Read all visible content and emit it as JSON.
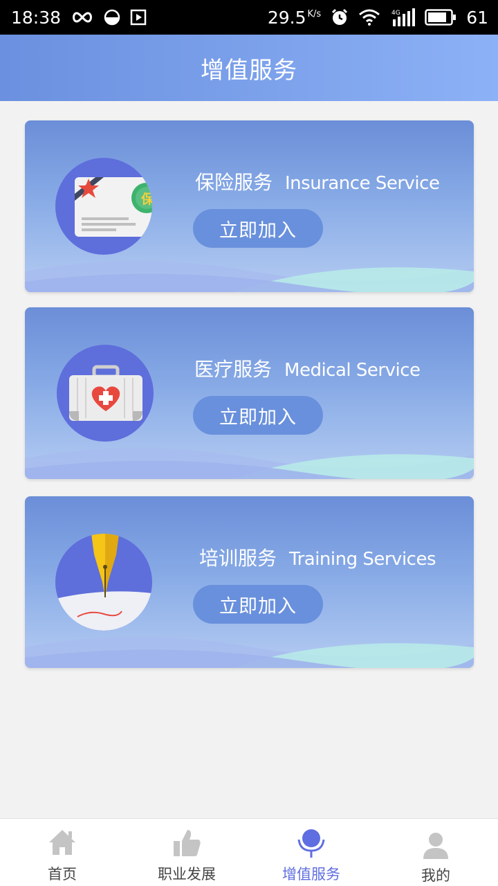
{
  "status_bar": {
    "time": "18:38",
    "speed": "29.5",
    "speed_unit": "K/s",
    "network": "4G",
    "battery": "61"
  },
  "header": {
    "title": "增值服务"
  },
  "cards": [
    {
      "title_cn": "保险服务",
      "title_en": "Insurance Service",
      "button": "立即加入",
      "icon": "insurance-card-icon",
      "badge_char": "保"
    },
    {
      "title_cn": "医疗服务",
      "title_en": "Medical Service",
      "button": "立即加入",
      "icon": "medical-kit-icon"
    },
    {
      "title_cn": "培训服务",
      "title_en": "Training Services",
      "button": "立即加入",
      "icon": "fountain-pen-icon"
    }
  ],
  "nav": {
    "items": [
      {
        "label": "首页",
        "icon": "home-icon"
      },
      {
        "label": "职业发展",
        "icon": "thumbs-up-icon"
      },
      {
        "label": "增值服务",
        "icon": "value-service-icon",
        "active": true
      },
      {
        "label": "我的",
        "icon": "user-icon"
      }
    ]
  },
  "colors": {
    "header_start": "#6b90df",
    "header_end": "#8cb1f6",
    "accent": "#5f6ee0",
    "button": "#6990dc",
    "circle": "#5e6edb"
  }
}
